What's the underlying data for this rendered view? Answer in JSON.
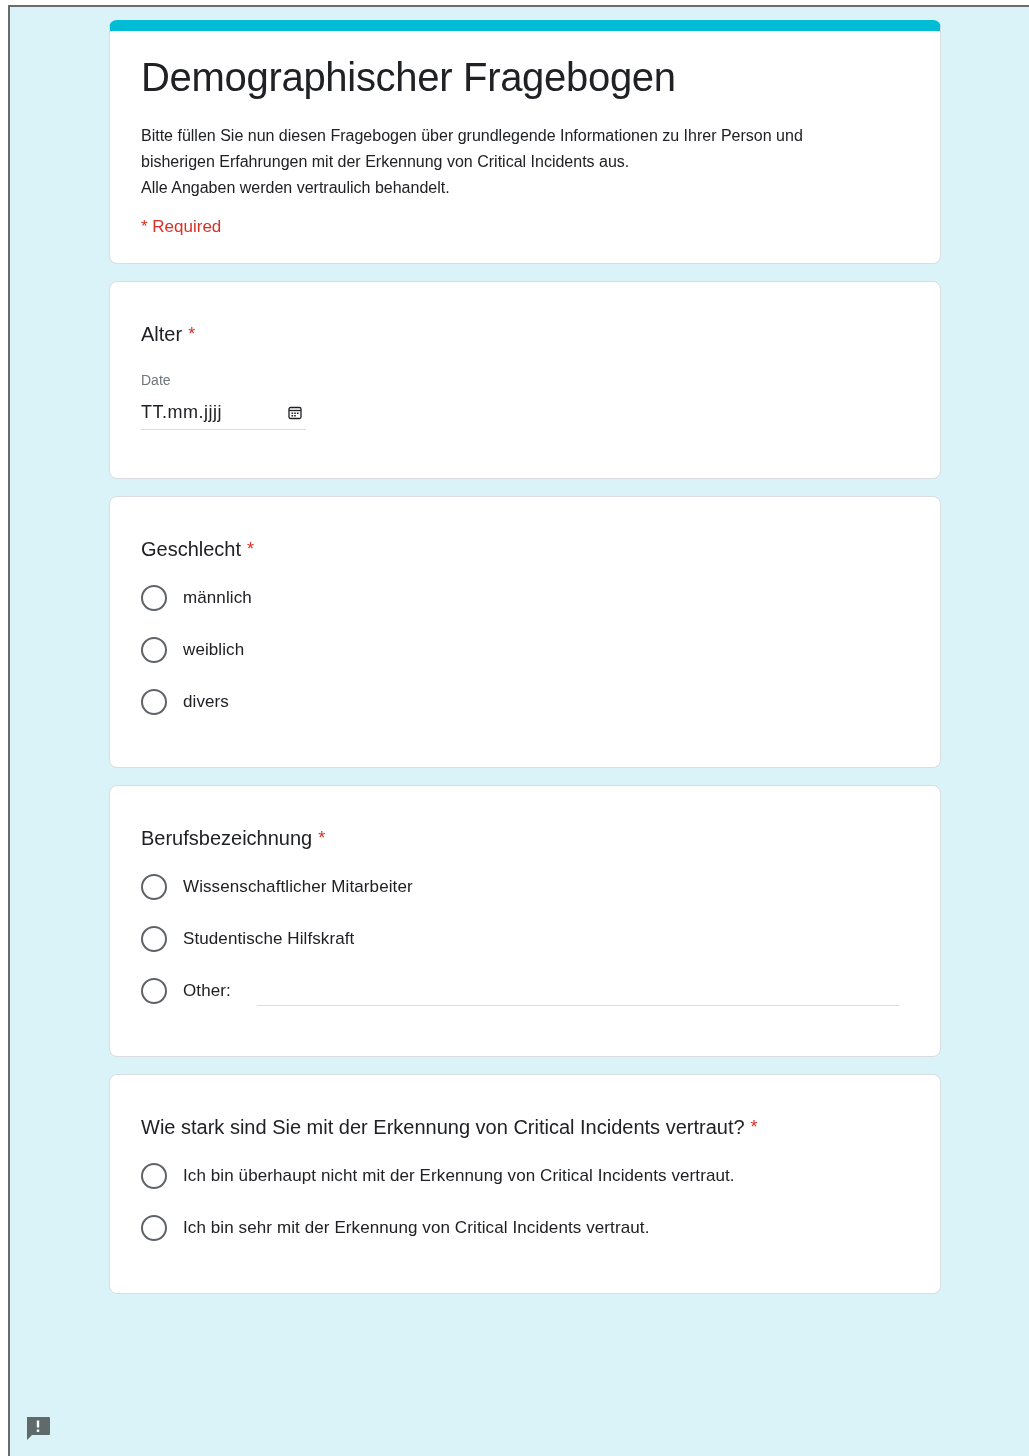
{
  "header": {
    "title": "Demographischer Fragebogen",
    "description": [
      "Bitte füllen Sie nun diesen Fragebogen über grundlegende Informationen zu Ihrer Person und bisherigen Erfahrungen mit der Erkennung von Critical Incidents aus.",
      "Alle Angaben werden vertraulich behandelt."
    ],
    "required_note": "* Required"
  },
  "questions": [
    {
      "kind": "date",
      "title": "Alter",
      "required_mark": "*",
      "field_label": "Date",
      "placeholder": "TT.mm.jjjj"
    },
    {
      "kind": "radio",
      "title": "Geschlecht",
      "required_mark": "*",
      "options": [
        {
          "kind": "plain",
          "label": "männlich",
          "selected": false
        },
        {
          "kind": "plain",
          "label": "weiblich",
          "selected": false
        },
        {
          "kind": "plain",
          "label": "divers",
          "selected": false
        }
      ]
    },
    {
      "kind": "radio",
      "title": "Berufsbezeichnung",
      "required_mark": "*",
      "options": [
        {
          "kind": "plain",
          "label": "Wissenschaftlicher Mitarbeiter",
          "selected": false
        },
        {
          "kind": "plain",
          "label": "Studentische Hilfskraft",
          "selected": false
        },
        {
          "kind": "other",
          "label": "Other:",
          "selected": false
        }
      ]
    },
    {
      "kind": "radio",
      "title": "Wie stark sind Sie mit der Erkennung von Critical Incidents vertraut?",
      "required_mark": "*",
      "options": [
        {
          "kind": "plain",
          "label": "Ich bin überhaupt nicht mit der Erkennung von Critical Incidents vertraut.",
          "selected": false
        },
        {
          "kind": "plain",
          "label": "Ich bin sehr mit der Erkennung von Critical Incidents vertraut.",
          "selected": false
        }
      ]
    }
  ]
}
